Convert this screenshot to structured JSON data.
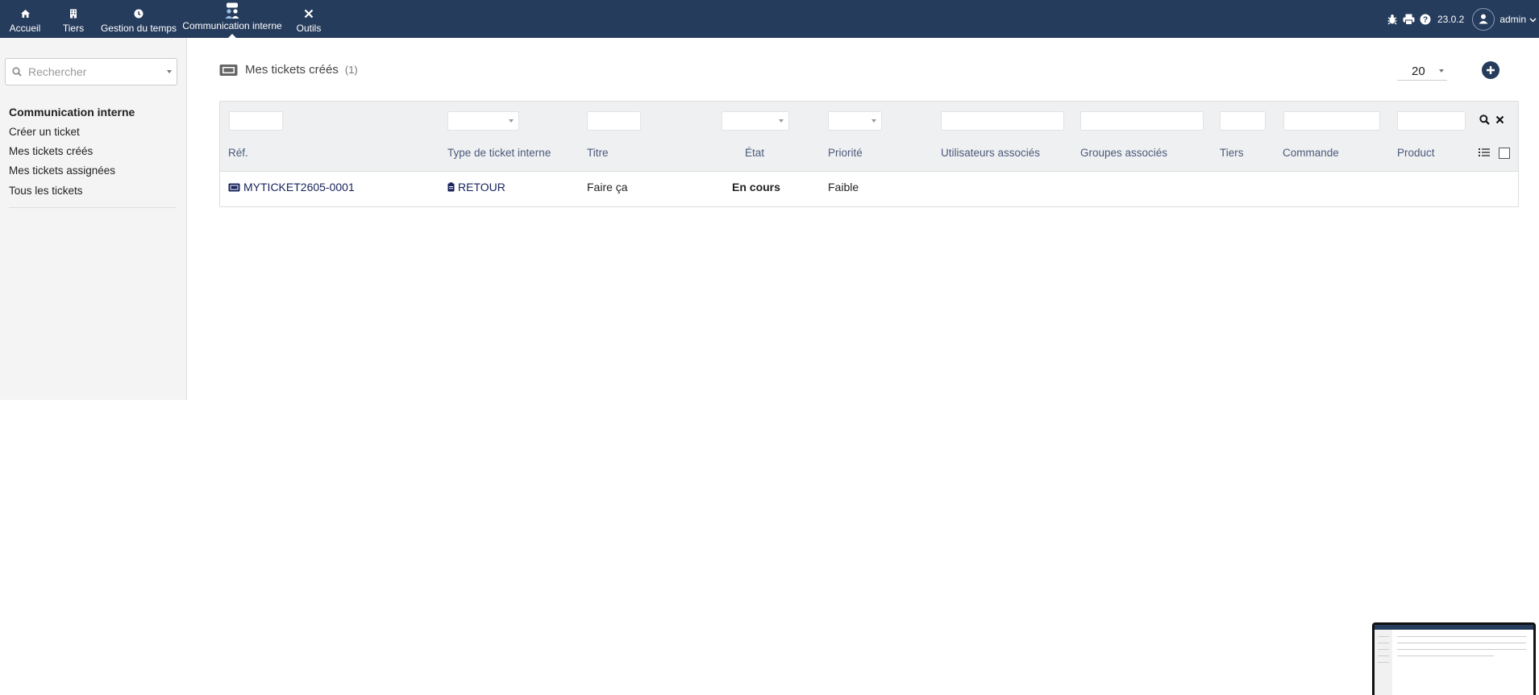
{
  "nav": {
    "items": [
      {
        "label": "Accueil",
        "icon": "home-icon"
      },
      {
        "label": "Tiers",
        "icon": "building-icon"
      },
      {
        "label": "Gestion du temps",
        "icon": "clock-icon"
      },
      {
        "label": "Communication interne",
        "icon": "people-chat-icon"
      },
      {
        "label": "Outils",
        "icon": "tools-icon"
      }
    ],
    "active_index": 3
  },
  "header_right": {
    "version": "23.0.2",
    "user": "admin"
  },
  "sidebar": {
    "search_placeholder": "Rechercher",
    "section_title": "Communication interne",
    "links": [
      "Créer un ticket",
      "Mes tickets créés",
      "Mes tickets assignées",
      "Tous les tickets"
    ]
  },
  "page": {
    "title": "Mes tickets créés",
    "count": "(1)",
    "per_page": "20"
  },
  "table": {
    "headers": {
      "ref": "Réf.",
      "type": "Type de ticket interne",
      "title": "Titre",
      "state": "État",
      "priority": "Priorité",
      "users": "Utilisateurs associés",
      "groups": "Groupes associés",
      "tiers": "Tiers",
      "order": "Commande",
      "product": "Product"
    },
    "rows": [
      {
        "ref": "MYTICKET2605-0001",
        "type": "RETOUR",
        "title": "Faire ça",
        "state": "En cours",
        "priority": "Faible"
      }
    ]
  },
  "colors": {
    "topbar": "#263c5c",
    "link": "#17235a",
    "header_text": "#4a5a7a"
  }
}
